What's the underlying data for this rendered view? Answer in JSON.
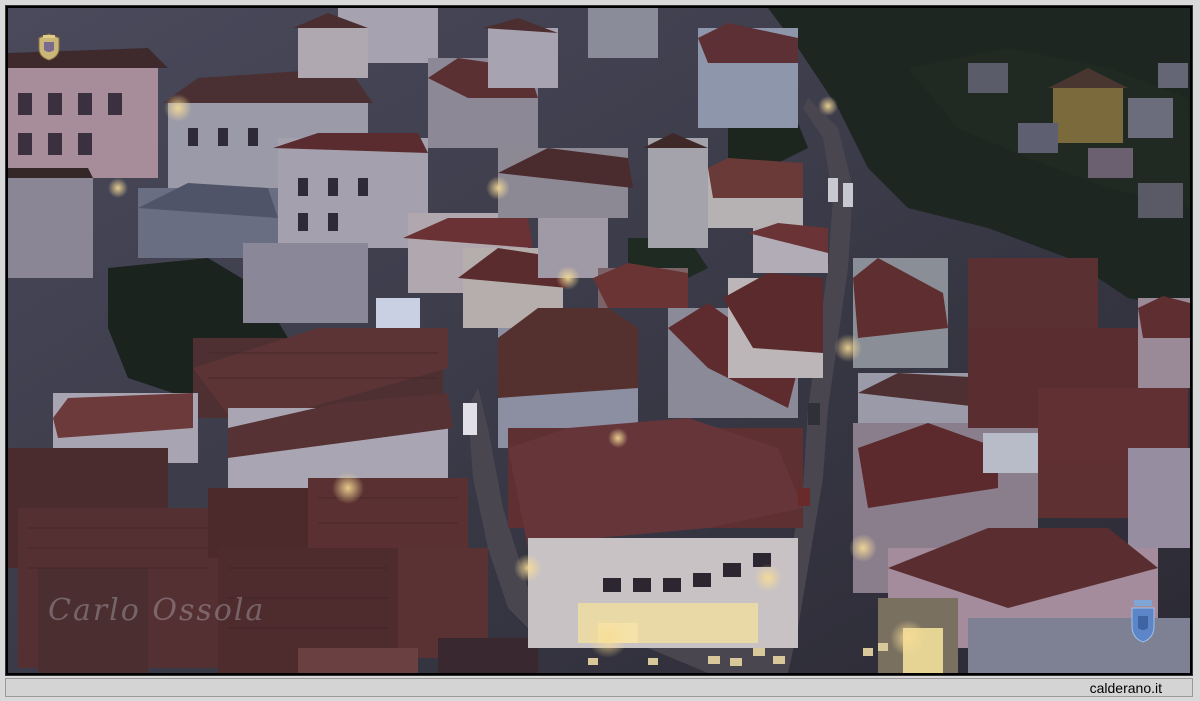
{
  "photo": {
    "subject": "",
    "watermark_signature": "Carlo Ossola"
  },
  "footer": {
    "site_label": "calderano.it"
  },
  "colors": {
    "roof_tile": "#5a3030",
    "roof_tile_dark": "#402426",
    "facade": "#8e8a9a",
    "street_light": "#f2d48a",
    "foliage": "#1e2a22",
    "frame_bg": "#d9d9d9"
  },
  "icons": {
    "top_left": "coat-of-arms-icon",
    "bottom_right": "coat-of-arms-icon"
  }
}
